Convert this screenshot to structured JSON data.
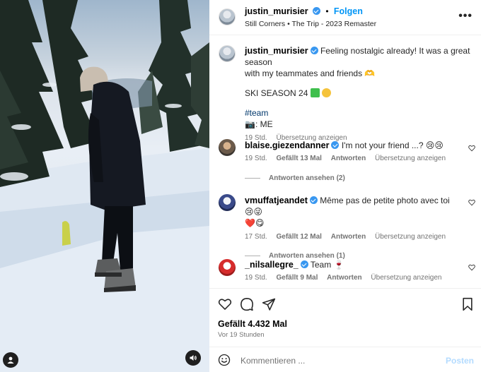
{
  "media": {
    "profile_button_icon": "user-icon",
    "sound_button_icon": "speaker-icon"
  },
  "header": {
    "username": "justin_murisier",
    "separator": "•",
    "follow_label": "Folgen",
    "audio": "Still Corners • The Trip - 2023 Remaster",
    "more_icon": "more-horizontal-icon",
    "more_label": "•••"
  },
  "caption": {
    "username": "justin_murisier",
    "text_line1": "Feeling nostalgic already! It was a great season",
    "text_line2": "with my teammates and friends 🫶",
    "season": "SKI SEASON 24",
    "hashtag": "#team",
    "credit": "📷: ME",
    "time": "19 Std.",
    "translate": "Übersetzung anzeigen"
  },
  "comments": [
    {
      "username": "blaise.giezendanner",
      "text": "I'm not your friend ...? 😢😢",
      "time": "19 Std.",
      "likes": "Gefällt 13 Mal",
      "reply": "Antworten",
      "translate": "Übersetzung anzeigen",
      "view_replies": "Antworten ansehen (2)"
    },
    {
      "username": "vmuffatjeandet",
      "text_line1": "Même pas de petite photo avec toi 😢😜",
      "text_line2": "❤️😋",
      "time": "17 Std.",
      "likes": "Gefällt 12 Mal",
      "reply": "Antworten",
      "translate": "Übersetzung anzeigen",
      "view_replies": "Antworten ansehen (1)"
    },
    {
      "username": "_nilsallegre_",
      "text": "Team 🍷",
      "time": "19 Std.",
      "likes": "Gefällt 9 Mal",
      "reply": "Antworten",
      "translate": "Übersetzung anzeigen"
    }
  ],
  "footer": {
    "likes": "Gefällt 4.432 Mal",
    "ago": "Vor 19 Stunden",
    "comment_placeholder": "Kommentieren ...",
    "post_label": "Posten"
  },
  "colors": {
    "accent": "#0095f6",
    "verified": "#3897f0",
    "muted": "#737373"
  }
}
